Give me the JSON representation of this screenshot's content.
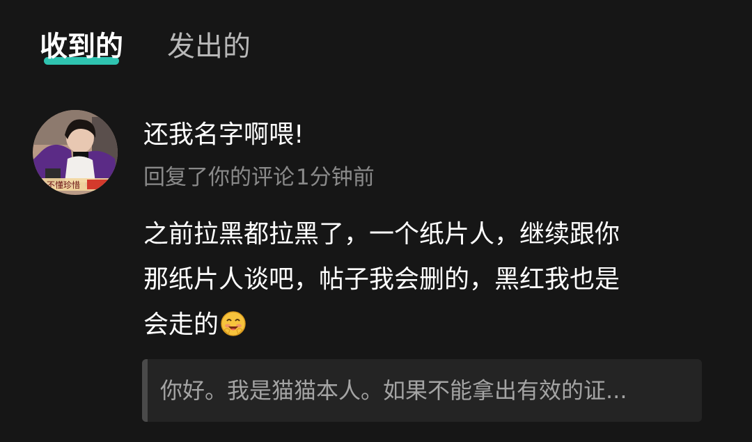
{
  "tabs": {
    "received": "收到的",
    "sent": "发出的",
    "accent_color": "#2fc3b0"
  },
  "notification": {
    "username": "还我名字啊喂!",
    "action": "回复了你的评论",
    "time": "1分钟前",
    "avatar_icon": "user-avatar",
    "avatar_text": "不懂珍惜",
    "comment_lines": [
      "之前拉黑都拉黑了，一个纸片人，继续跟你",
      "那纸片人谈吧，帖子我会删的，黑红我也是",
      "会走的"
    ],
    "comment_emoji": "grinning-face-emoji",
    "quoted_text": "你好。我是猫猫本人。如果不能拿出有效的证..."
  }
}
